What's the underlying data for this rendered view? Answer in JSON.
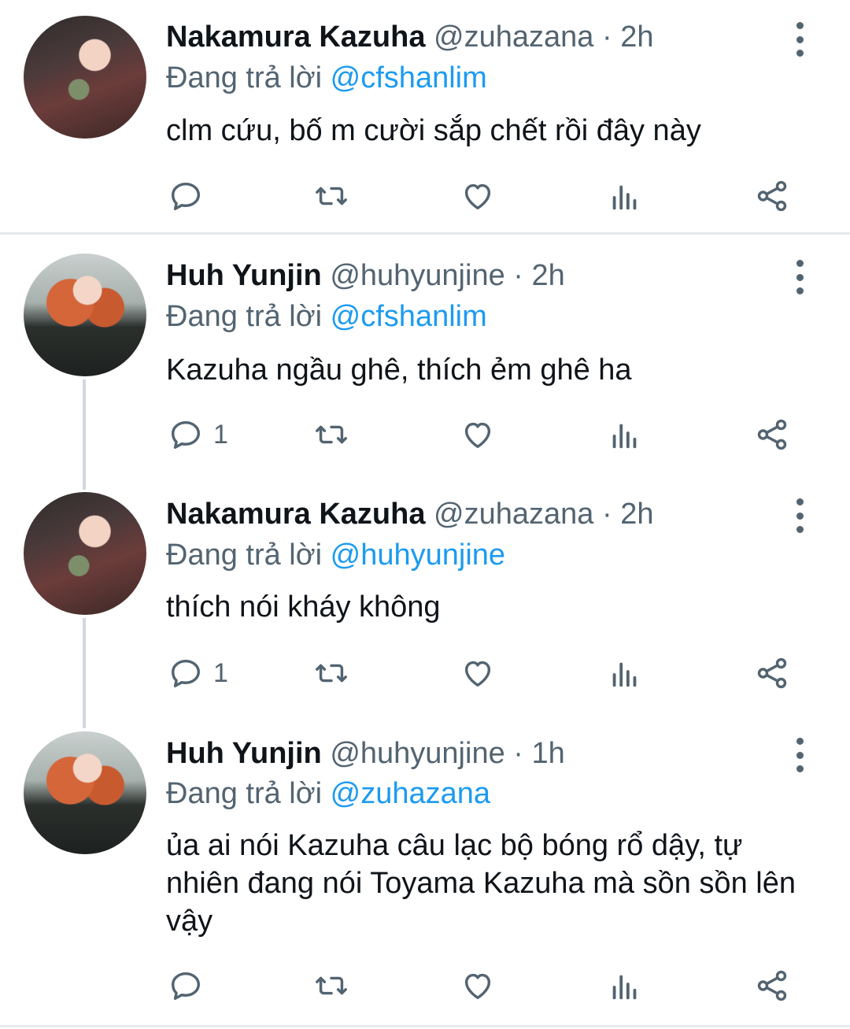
{
  "colors": {
    "link": "#1d9bf0",
    "muted": "#536471",
    "text": "#0f1419"
  },
  "tweets": [
    {
      "name": "Nakamura Kazuha",
      "handle": "@zuhazana",
      "time": "· 2h",
      "reply_prefix": "Đang trả lời",
      "reply_to": "@cfshanlim",
      "text": "clm cứu, bố m cười sắp chết rồi đây này",
      "reply_count": ""
    },
    {
      "name": "Huh Yunjin",
      "handle": "@huhyunjine",
      "time": "· 2h",
      "reply_prefix": "Đang trả lời",
      "reply_to": "@cfshanlim",
      "text": "Kazuha ngầu ghê, thích ẻm ghê ha",
      "reply_count": "1"
    },
    {
      "name": "Nakamura Kazuha",
      "handle": "@zuhazana",
      "time": "· 2h",
      "reply_prefix": "Đang trả lời",
      "reply_to": "@huhyunjine",
      "text": "thích nói kháy không",
      "reply_count": "1"
    },
    {
      "name": "Huh Yunjin",
      "handle": "@huhyunjine",
      "time": "· 1h",
      "reply_prefix": "Đang trả lời",
      "reply_to": "@zuhazana",
      "text": "ủa ai nói Kazuha câu lạc bộ bóng rổ dậy, tự nhiên đang nói Toyama Kazuha mà sồn sồn lên vậy",
      "reply_count": ""
    }
  ],
  "icons": [
    "reply-icon",
    "retweet-icon",
    "like-icon",
    "views-icon",
    "share-icon",
    "more-icon"
  ]
}
